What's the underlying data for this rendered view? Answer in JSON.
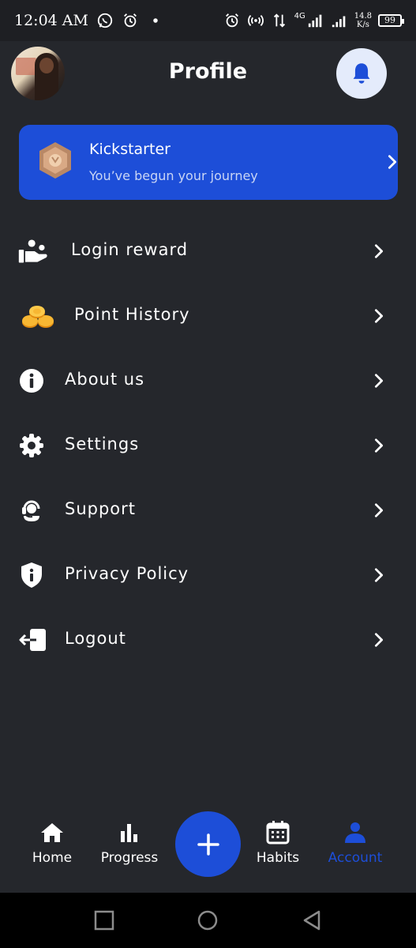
{
  "status_bar": {
    "time": "12:04 AM",
    "network_speed_value": "14.8",
    "network_speed_unit": "K/s",
    "network_type": "4G",
    "battery_level": "99"
  },
  "header": {
    "title": "Profile"
  },
  "banner": {
    "title": "Kickstarter",
    "subtitle": "You’ve begun your journey"
  },
  "menu": {
    "items": [
      {
        "label": "Login reward",
        "icon": "login-reward-icon"
      },
      {
        "label": "Point History",
        "icon": "coins-icon"
      },
      {
        "label": "About us",
        "icon": "info-icon"
      },
      {
        "label": "Settings",
        "icon": "gear-icon"
      },
      {
        "label": "Support",
        "icon": "headset-icon"
      },
      {
        "label": "Privacy Policy",
        "icon": "shield-info-icon"
      },
      {
        "label": "Logout",
        "icon": "logout-icon"
      }
    ]
  },
  "bottom_nav": {
    "items": [
      {
        "label": "Home",
        "icon": "home-icon",
        "active": false
      },
      {
        "label": "Progress",
        "icon": "bar-chart-icon",
        "active": false
      },
      {
        "label": "Habits",
        "icon": "calendar-icon",
        "active": false
      },
      {
        "label": "Account",
        "icon": "user-icon",
        "active": true
      }
    ]
  },
  "colors": {
    "background": "#25272c",
    "accent": "#1d4ed8",
    "bell_button_bg": "#e4ebfb",
    "text": "#ffffff"
  }
}
